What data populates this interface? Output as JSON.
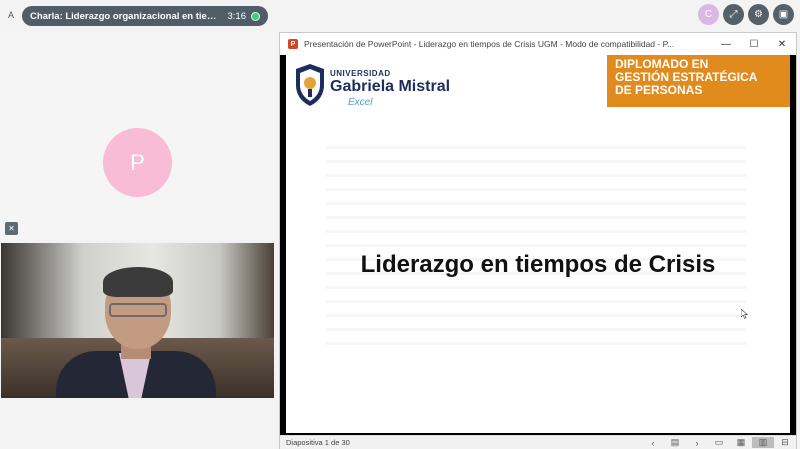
{
  "topbar": {
    "brand_letter": "A",
    "call_title": "Charla: Liderazgo organizacional en tiempos de Crisis",
    "call_timer": "3:16",
    "user_avatar_letter": "C"
  },
  "participants": {
    "avatar_letter": "P"
  },
  "ppt": {
    "window_title": "Presentación de PowerPoint - Liderazgo en tiempos de Crisis UGM - Modo de compatibilidad - P...",
    "status_text": "Diapositiva 1 de 30"
  },
  "slide": {
    "logo_university": "UNIVERSIDAD",
    "logo_name": "Gabriela Mistral",
    "logo_sub": "Excel",
    "diploma_lines": [
      "DIPLOMADO EN",
      "GESTIÓN ESTRATÉGICA",
      "DE PERSONAS"
    ],
    "title": "Liderazgo en tiempos de Crisis"
  },
  "colors": {
    "pill": "#4e5d66",
    "live": "#3ccb7f",
    "diploma_bg": "#e18a1e",
    "brand_navy": "#1d2e5c",
    "avatar_pink": "#f8bcd7"
  }
}
